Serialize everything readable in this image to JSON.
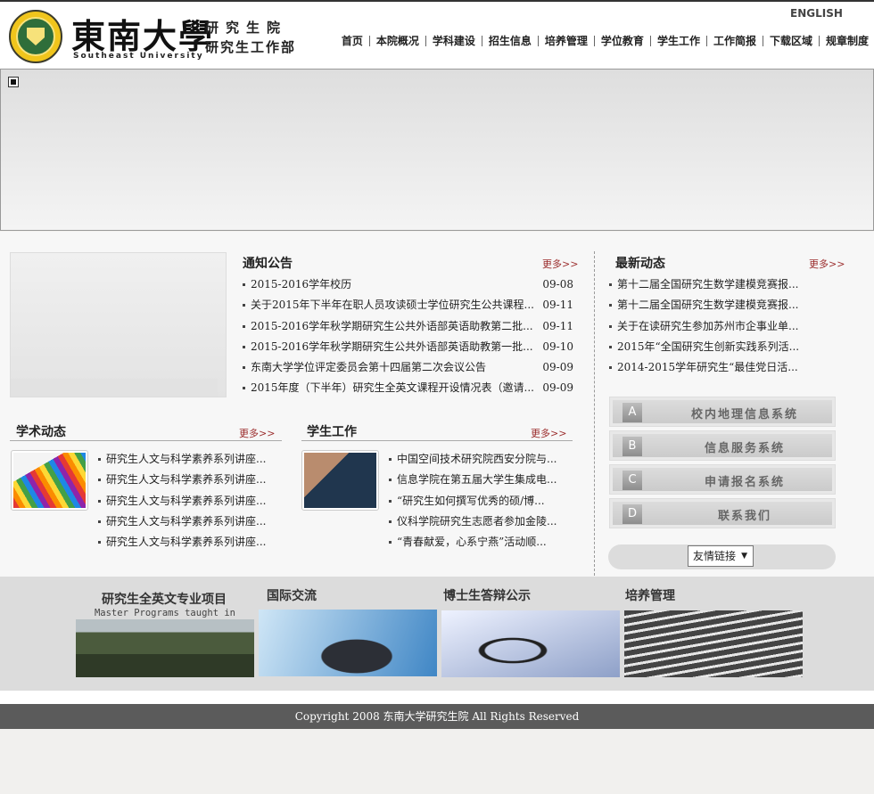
{
  "header": {
    "logo_seal_text": "东南大学",
    "logo_cn": "東南大學",
    "logo_en": "Southeast University",
    "dept_line1": "研究生院",
    "dept_line2": "研究生工作部",
    "english_link": "ENGLISH",
    "nav": [
      "首页",
      "本院概况",
      "学科建设",
      "招生信息",
      "培养管理",
      "学位教育",
      "学生工作",
      "工作简报",
      "下载区域",
      "规章制度"
    ]
  },
  "notices": {
    "title": "通知公告",
    "more": "更多>>",
    "items": [
      {
        "text": "2015-2016学年校历",
        "date": "09-08"
      },
      {
        "text": "关于2015年下半年在职人员攻读硕士学位研究生公共课程...",
        "date": "09-11"
      },
      {
        "text": "2015-2016学年秋学期研究生公共外语部英语助教第二批...",
        "date": "09-11"
      },
      {
        "text": "2015-2016学年秋学期研究生公共外语部英语助教第一批...",
        "date": "09-10"
      },
      {
        "text": "东南大学学位评定委员会第十四届第二次会议公告",
        "date": "09-09"
      },
      {
        "text": "2015年度（下半年）研究生全英文课程开设情况表（邀请...",
        "date": "09-09"
      }
    ]
  },
  "news": {
    "title": "最新动态",
    "more": "更多>>",
    "items": [
      "第十二届全国研究生数学建模竞赛报...",
      "第十二届全国研究生数学建模竞赛报...",
      "关于在读研究生参加苏州市企事业单...",
      "2015年“全国研究生创新实践系列活...",
      "2014-2015学年研究生“最佳党日活..."
    ]
  },
  "academic": {
    "title": "学术动态",
    "more": "更多>>",
    "items": [
      "研究生人文与科学素养系列讲座...",
      "研究生人文与科学素养系列讲座...",
      "研究生人文与科学素养系列讲座...",
      "研究生人文与科学素养系列讲座...",
      "研究生人文与科学素养系列讲座..."
    ]
  },
  "student_work": {
    "title": "学生工作",
    "more": "更多>>",
    "items": [
      "中国空间技术研究院西安分院与...",
      "信息学院在第五届大学生集成电...",
      "“研究生如何撰写优秀的硕/博...",
      "仪科学院研究生志愿者参加金陵...",
      "“青春献爱，心系宁燕”活动顺..."
    ]
  },
  "systems": [
    {
      "letter": "A",
      "label": "校内地理信息系统"
    },
    {
      "letter": "B",
      "label": "信息服务系统"
    },
    {
      "letter": "C",
      "label": "申请报名系统"
    },
    {
      "letter": "D",
      "label": "联系我们"
    }
  ],
  "friend_links": {
    "selected": "友情链接"
  },
  "promos": [
    {
      "title": "研究生全英文专业项目",
      "subtitle": "Master Programs taught in English"
    },
    {
      "title": "国际交流",
      "subtitle": ""
    },
    {
      "title": "博士生答辩公示",
      "subtitle": ""
    },
    {
      "title": "培养管理",
      "subtitle": ""
    }
  ],
  "footer": {
    "copyright": "Copyright 2008 东南大学研究生院 All Rights Reserved"
  }
}
